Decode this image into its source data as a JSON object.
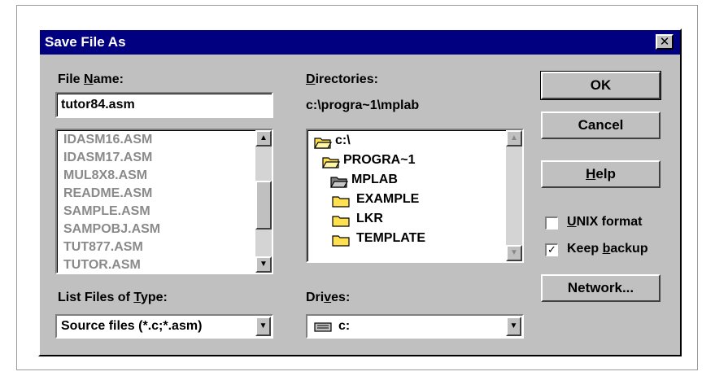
{
  "dialog": {
    "title": "Save File As",
    "close_symbol": "✕"
  },
  "file_name": {
    "label_pre": "File ",
    "label_key": "N",
    "label_post": "ame:",
    "value": "tutor84.asm",
    "files": [
      "IDASM16.ASM",
      "IDASM17.ASM",
      "MUL8X8.ASM",
      "README.ASM",
      "SAMPLE.ASM",
      "SAMPOBJ.ASM",
      "TUT877.ASM",
      "TUTOR.ASM"
    ]
  },
  "directories": {
    "label_key": "D",
    "label_post": "irectories:",
    "current_path": "c:\\progra~1\\mplab",
    "tree": [
      "c:\\",
      "PROGRA~1",
      "MPLAB",
      "EXAMPLE",
      "LKR",
      "TEMPLATE"
    ]
  },
  "file_type": {
    "label_pre": "List Files of ",
    "label_key": "T",
    "label_post": "ype:",
    "selected": "Source files (*.c;*.asm)"
  },
  "drives": {
    "label_pre": "Dri",
    "label_key": "v",
    "label_post": "es:",
    "selected": "c:"
  },
  "buttons": {
    "ok": "OK",
    "cancel": "Cancel",
    "help_key": "H",
    "help_post": "elp",
    "network": "Network..."
  },
  "options": {
    "unix_key": "U",
    "unix_post": "NIX format",
    "unix_checked": false,
    "backup_pre": "Keep ",
    "backup_key": "b",
    "backup_post": "ackup",
    "backup_checked": true,
    "check_symbol": "✓"
  },
  "icons": {
    "close": "close-icon",
    "folder_open": "folder-open-icon",
    "folder": "folder-icon",
    "drive": "drive-icon",
    "scroll_up": "scroll-up-arrow-icon",
    "scroll_down": "scroll-down-arrow-icon",
    "dropdown": "dropdown-arrow-icon"
  },
  "colors": {
    "titlebar": "#000080",
    "face": "#c0c0c0",
    "folder": "#ffe050"
  }
}
